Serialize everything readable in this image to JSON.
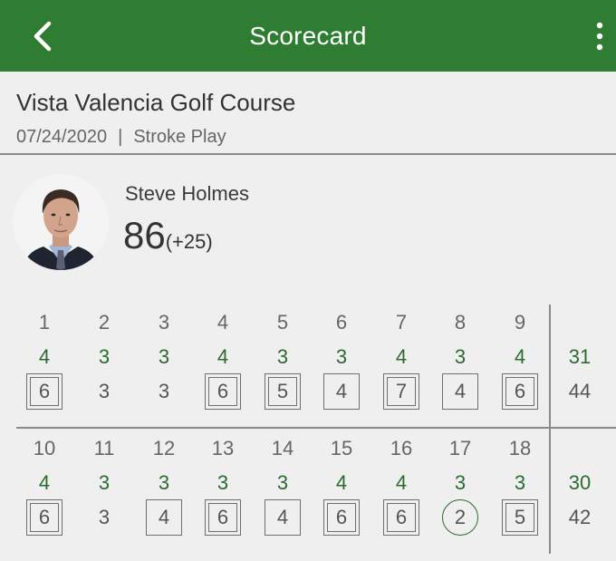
{
  "header": {
    "title": "Scorecard",
    "back_icon": "chevron-left-icon",
    "menu_icon": "more-vertical-icon",
    "color": "#2f7d32"
  },
  "course": {
    "name": "Vista Valencia Golf Course",
    "date": "07/24/2020",
    "separator": "|",
    "format": "Stroke Play"
  },
  "player": {
    "name": "Steve Holmes",
    "total": "86",
    "diff": "(+25)"
  },
  "front": {
    "holes": [
      "1",
      "2",
      "3",
      "4",
      "5",
      "6",
      "7",
      "8",
      "9"
    ],
    "par": [
      "4",
      "3",
      "3",
      "4",
      "3",
      "3",
      "4",
      "3",
      "4"
    ],
    "strokes": [
      "6",
      "3",
      "3",
      "6",
      "5",
      "4",
      "7",
      "4",
      "6"
    ],
    "marks": [
      "double-bogey",
      "none",
      "none",
      "double-bogey",
      "double-bogey",
      "bogey",
      "double-bogey",
      "bogey",
      "double-bogey"
    ],
    "par_total": "31",
    "score_total": "44"
  },
  "back": {
    "holes": [
      "10",
      "11",
      "12",
      "13",
      "14",
      "15",
      "16",
      "17",
      "18"
    ],
    "par": [
      "4",
      "3",
      "3",
      "3",
      "3",
      "4",
      "4",
      "3",
      "3"
    ],
    "strokes": [
      "6",
      "3",
      "4",
      "6",
      "4",
      "6",
      "6",
      "2",
      "5"
    ],
    "marks": [
      "double-bogey",
      "none",
      "bogey",
      "double-bogey",
      "bogey",
      "double-bogey",
      "double-bogey",
      "birdie",
      "double-bogey"
    ],
    "par_total": "30",
    "score_total": "42"
  },
  "colors": {
    "par_green": "#2b6b2f",
    "background": "#f0efef"
  }
}
